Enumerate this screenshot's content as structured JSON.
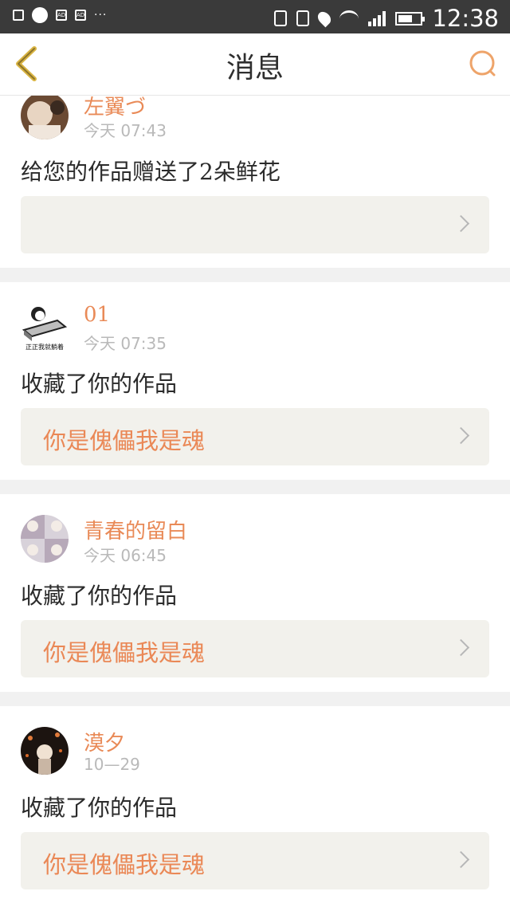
{
  "status_bar": {
    "time": "12:38",
    "left_icons": [
      "image-icon",
      "circle-icon",
      "ad-icon",
      "ad-icon"
    ],
    "more": "···",
    "network": "4G"
  },
  "header": {
    "title": "消息",
    "back_icon": "chevron-left-icon",
    "search_icon": "search-icon",
    "accent_color": "#e9a35a"
  },
  "messages": [
    {
      "user": "左翼づ",
      "time": "今天 07:43",
      "action": "给您的作品赠送了2朵鲜花",
      "work_title": ""
    },
    {
      "user": "01",
      "time": "今天 07:35",
      "action": "收藏了你的作品",
      "work_title": "你是傀儡我是魂"
    },
    {
      "user": "青春的留白",
      "time": "今天 06:45",
      "action": "收藏了你的作品",
      "work_title": "你是傀儡我是魂"
    },
    {
      "user": "漠夕",
      "time": "10—29",
      "action": "收藏了你的作品",
      "work_title": "你是傀儡我是魂"
    }
  ],
  "avatar_caption": "正正我就躺着",
  "colors": {
    "accent": "#e98a57",
    "status_bar": "#3a3a3a",
    "card_bg": "#ffffff",
    "work_bg": "#f2f1ec"
  }
}
